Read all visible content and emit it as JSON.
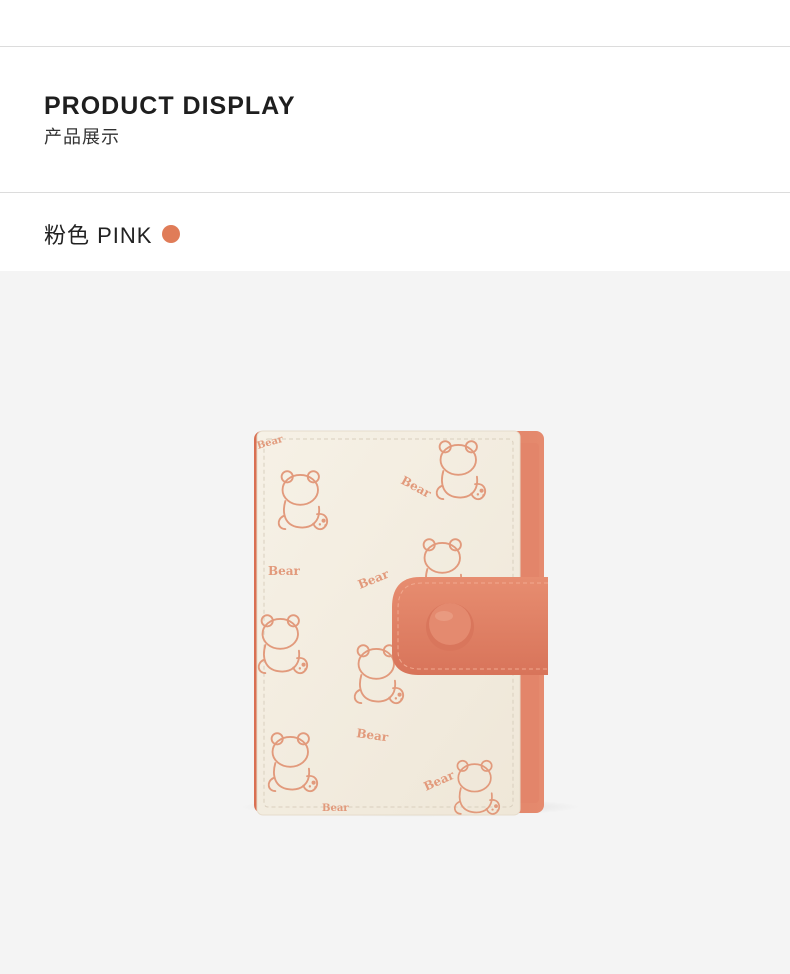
{
  "header": {
    "title_en": "PRODUCT DISPLAY",
    "title_zh": "产品展示"
  },
  "color_option": {
    "label": "粉色 PINK",
    "swatch_color": "#e07c58"
  },
  "product": {
    "print_text": "Bear",
    "body_color": "#f3ecdf",
    "accent_color": "#e08266",
    "background_color": "#f4f4f4"
  }
}
